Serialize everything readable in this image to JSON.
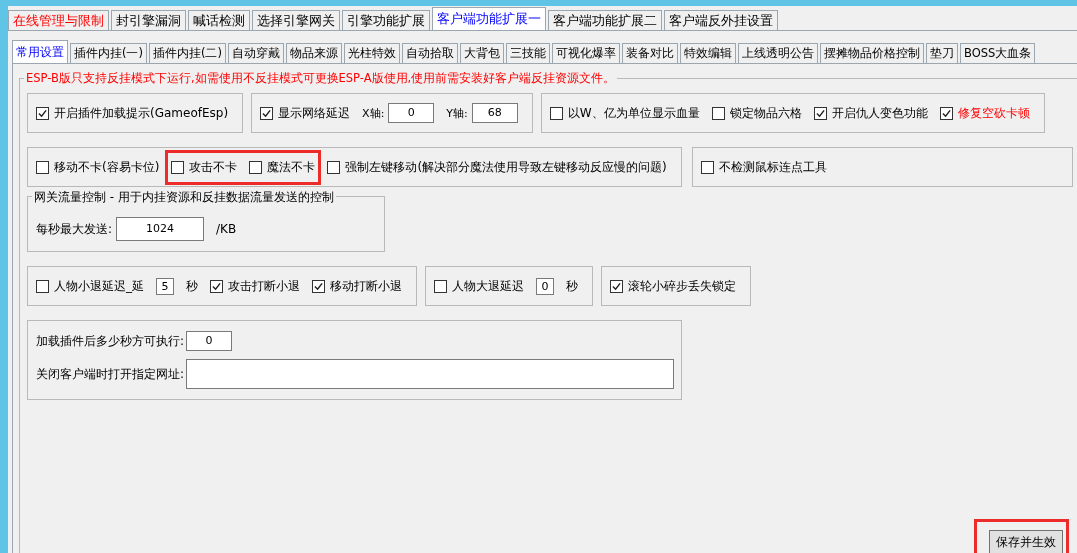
{
  "top_tabs": [
    {
      "label": "在线管理与限制",
      "selected": false,
      "emphasis": true
    },
    {
      "label": "封引擎漏洞",
      "selected": false
    },
    {
      "label": "喊话检测",
      "selected": false
    },
    {
      "label": "选择引擎网关",
      "selected": false
    },
    {
      "label": "引擎功能扩展",
      "selected": false
    },
    {
      "label": "客户端功能扩展一",
      "selected": true
    },
    {
      "label": "客户端功能扩展二",
      "selected": false
    },
    {
      "label": "客户端反外挂设置",
      "selected": false
    }
  ],
  "sub_tabs": [
    {
      "label": "常用设置",
      "selected": true
    },
    {
      "label": "插件内挂(一)",
      "selected": false
    },
    {
      "label": "插件内挂(二)",
      "selected": false
    },
    {
      "label": "自动穿戴",
      "selected": false
    },
    {
      "label": "物品来源",
      "selected": false
    },
    {
      "label": "光柱特效",
      "selected": false
    },
    {
      "label": "自动拾取",
      "selected": false
    },
    {
      "label": "大背包",
      "selected": false
    },
    {
      "label": "三技能",
      "selected": false
    },
    {
      "label": "可视化爆率",
      "selected": false
    },
    {
      "label": "装备对比",
      "selected": false
    },
    {
      "label": "特效编辑",
      "selected": false
    },
    {
      "label": "上线透明公告",
      "selected": false
    },
    {
      "label": "摆摊物品价格控制",
      "selected": false
    },
    {
      "label": "垫刀",
      "selected": false
    },
    {
      "label": "BOSS大血条",
      "selected": false
    }
  ],
  "notice": "ESP-B版只支持反挂模式下运行,如需使用不反挂模式可更换ESP-A版使用,使用前需安装好客户端反挂资源文件。",
  "rows": [
    [
      {
        "kind": "box",
        "items": [
          {
            "kind": "checkbox",
            "label": "开启插件加载提示(GameofEsp)",
            "checked": true
          }
        ]
      },
      {
        "kind": "box",
        "items": [
          {
            "kind": "checkbox",
            "label": "显示网络延迟",
            "checked": true
          },
          {
            "kind": "field",
            "label": "X轴:",
            "value": "0"
          },
          {
            "kind": "field",
            "label": "Y轴:",
            "value": "68"
          }
        ]
      },
      {
        "kind": "box",
        "items": [
          {
            "kind": "checkbox",
            "label": "以W、亿为单位显示血量",
            "checked": false
          },
          {
            "kind": "checkbox",
            "label": "锁定物品六格",
            "checked": false
          },
          {
            "kind": "checkbox",
            "label": "开启仇人变色功能",
            "checked": true
          },
          {
            "kind": "checkbox",
            "label": "修复空砍卡顿",
            "checked": true,
            "emphasis": true
          }
        ]
      }
    ],
    [
      {
        "kind": "box",
        "items": [
          {
            "kind": "checkbox",
            "label": "移动不卡(容易卡位)",
            "checked": false
          },
          {
            "kind": "checkbox",
            "label": "攻击不卡",
            "checked": false,
            "highlighted": true
          },
          {
            "kind": "checkbox",
            "label": "魔法不卡",
            "checked": false,
            "highlighted": true
          },
          {
            "kind": "checkbox",
            "label": "强制左键移动(解决部分魔法使用导致左键移动反应慢的问题)",
            "checked": false
          }
        ]
      },
      {
        "kind": "box",
        "items": [
          {
            "kind": "checkbox",
            "label": "不检测鼠标连点工具",
            "checked": false
          }
        ]
      }
    ],
    [
      {
        "kind": "group",
        "title": "网关流量控制 - 用于内挂资源和反挂数据流量发送的控制",
        "items": [
          {
            "kind": "field",
            "label": "每秒最大发送:",
            "value": "1024"
          },
          {
            "kind": "text",
            "text": "/KB"
          }
        ]
      }
    ],
    [
      {
        "kind": "box",
        "items": [
          {
            "kind": "checkbox",
            "label": "人物小退延迟_延",
            "checked": false
          },
          {
            "kind": "spin",
            "value": "5"
          },
          {
            "kind": "text",
            "text": "秒"
          },
          {
            "kind": "checkbox",
            "label": "攻击打断小退",
            "checked": true
          },
          {
            "kind": "checkbox",
            "label": "移动打断小退",
            "checked": true
          }
        ]
      },
      {
        "kind": "box",
        "items": [
          {
            "kind": "checkbox",
            "label": "人物大退延迟",
            "checked": false
          },
          {
            "kind": "spin",
            "value": "0"
          },
          {
            "kind": "text",
            "text": "秒"
          }
        ]
      },
      {
        "kind": "box",
        "items": [
          {
            "kind": "checkbox",
            "label": "滚轮小碎步丢失锁定",
            "checked": true
          }
        ]
      }
    ],
    [
      {
        "kind": "stack",
        "items": [
          {
            "kind": "field",
            "label": "加载插件后多少秒方可执行:",
            "value": "0"
          },
          {
            "kind": "field",
            "label": "关闭客户端时打开指定网址:"
          }
        ]
      }
    ]
  ],
  "save_button": {
    "label": "保存并生效",
    "highlighted": true
  }
}
